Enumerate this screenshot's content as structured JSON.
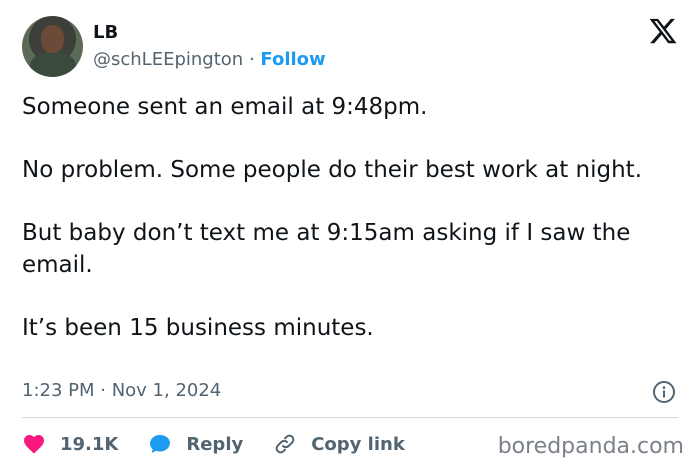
{
  "user": {
    "name": "LB",
    "handle": "@schLEEpington",
    "separator": "·",
    "follow_label": "Follow"
  },
  "tweet": {
    "paragraphs": [
      "Someone sent an email at 9:48pm.",
      "No problem. Some people do their best work at night.",
      "But baby don’t text me at 9:15am asking if I saw the email.",
      "It’s been 15 business minutes."
    ],
    "timestamp": "1:23 PM · Nov 1, 2024"
  },
  "actions": {
    "likes": "19.1K",
    "reply_label": "Reply",
    "copy_link_label": "Copy link"
  },
  "watermark": "boredpanda.com",
  "colors": {
    "accent": "#1d9bf0",
    "like": "#f91880",
    "secondary_text": "#536471",
    "primary_text": "#0f1419"
  },
  "icons": {
    "avatar": "avatar",
    "brand": "x-logo-icon",
    "info": "info-icon",
    "like": "heart-icon",
    "reply": "reply-bubble-icon",
    "copy": "link-icon"
  }
}
